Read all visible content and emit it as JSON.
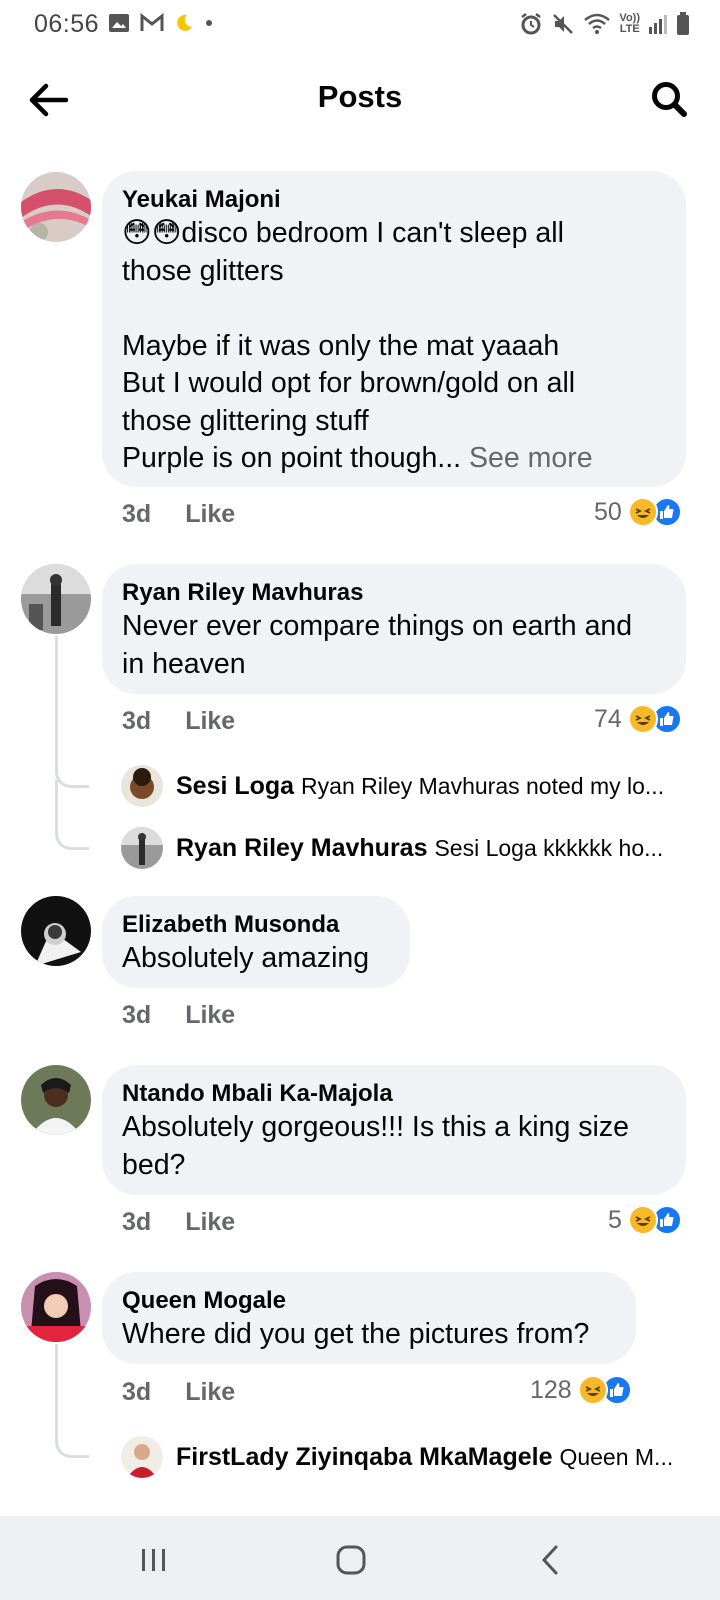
{
  "status_bar": {
    "time": "06:56",
    "network_label_top": "Vo))",
    "network_label_bottom": "LTE"
  },
  "header": {
    "title": "Posts"
  },
  "comments": [
    {
      "author": "Yeukai Majoni",
      "text": "😳😳disco bedroom I can't sleep all\nthose glitters\n\nMaybe if it was only the mat yaaah\nBut I would opt for brown/gold on all\nthose glittering stuff\nPurple is on point though...",
      "see_more": "See more",
      "time": "3d",
      "like": "Like",
      "reaction_count": "50"
    },
    {
      "author": "Ryan Riley Mavhuras",
      "text": "Never ever compare things on earth and\nin heaven",
      "time": "3d",
      "like": "Like",
      "reaction_count": "74",
      "replies": [
        {
          "author": "Sesi Loga",
          "text": "Ryan Riley Mavhuras noted my lo..."
        },
        {
          "author": "Ryan Riley Mavhuras",
          "text": "Sesi Loga kkkkkk ho..."
        }
      ]
    },
    {
      "author": "Elizabeth Musonda",
      "text": "Absolutely amazing",
      "time": "3d",
      "like": "Like"
    },
    {
      "author": "Ntando Mbali Ka-Majola",
      "text": "Absolutely gorgeous!!! Is this a king size\nbed?",
      "time": "3d",
      "like": "Like",
      "reaction_count": "5"
    },
    {
      "author": "Queen Mogale",
      "text": "Where did you get the pictures from?",
      "time": "3d",
      "like": "Like",
      "reaction_count": "128",
      "replies": [
        {
          "author": "FirstLady Ziyinqaba MkaMagele",
          "text": "Queen M..."
        }
      ]
    }
  ],
  "colors": {
    "bubble": "#f0f2f5",
    "secondary_text": "#65676b",
    "like_blue": "#1877f2",
    "haha_yellow": "#f7b928"
  }
}
